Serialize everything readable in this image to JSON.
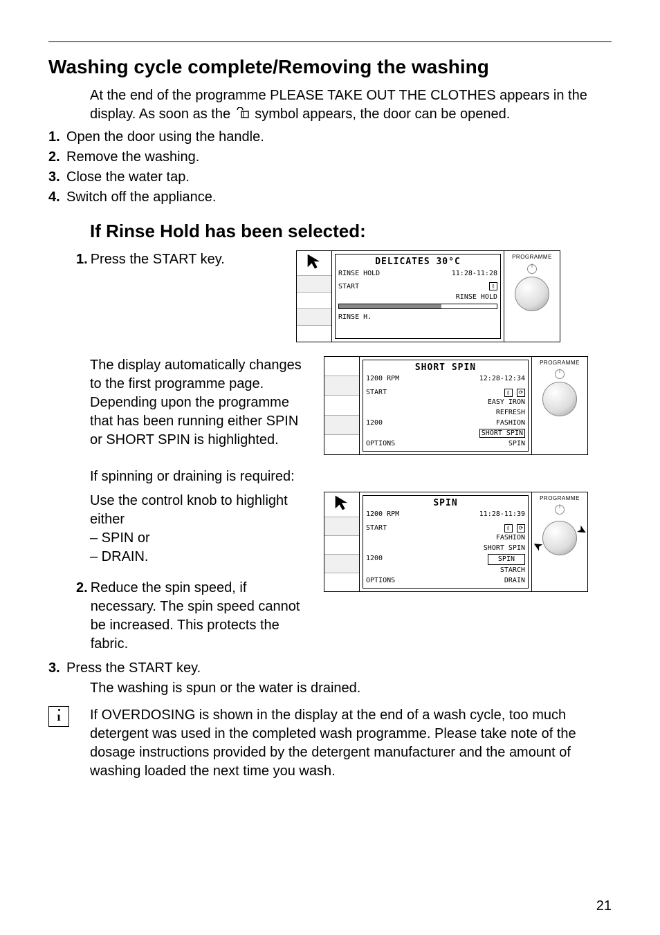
{
  "page_number": "21",
  "h1": "Washing cycle complete/Removing the washing",
  "intro": "At the end of the programme PLEASE TAKE OUT THE CLOTHES appears in the display. As soon as the      symbol appears, the door can be opened.",
  "steps_a": {
    "1": "Open the door using the handle.",
    "2": "Remove the washing.",
    "3": "Close the water tap.",
    "4": "Switch off the appliance."
  },
  "h2": "If Rinse Hold has been selected:",
  "steps_b": {
    "1": "Press the START key.",
    "text_after_fig1": "The display automatically changes to the first programme page. Depending upon the programme that has been running either SPIN or SHORT SPIN is highlighted.",
    "spin_intro": "If spinning or draining is required:",
    "spin_use": "Use the control knob to highlight either",
    "spin_opt1": "– SPIN or",
    "spin_opt2": "– DRAIN.",
    "2": "Reduce the spin speed, if necessary. The spin speed cannot be increased. This protects the fabric.",
    "3": "Press the START key.",
    "3b": "The washing is spun or the water is drained."
  },
  "note": "If OVERDOSING is shown in the display at the end of a wash cycle, too much detergent was used in the completed wash programme. Please take note of the dosage instructions provided by the detergent manufacturer and the amount of washing loaded the next time you wash.",
  "display1": {
    "title": "DELICATES 30°C",
    "top_left": "RINSE HOLD",
    "top_right": "11:28-11:28",
    "row_left": "START",
    "row_right_icon": "door",
    "mid_right": "RINSE HOLD",
    "bottom_left": "RINSE H.",
    "knob_label": "PROGRAMME"
  },
  "display2": {
    "title": "SHORT SPIN",
    "top_left": "1200 RPM",
    "top_right": "12:28-12:34",
    "row_left": "START",
    "menu": [
      "EASY IRON",
      "REFRESH",
      "FASHION",
      "SHORT SPIN",
      "SPIN"
    ],
    "left_mid": "1200",
    "left_bottom": "OPTIONS",
    "knob_label": "PROGRAMME"
  },
  "display3": {
    "title": "SPIN",
    "top_left": "1200 RPM",
    "top_right": "11:28-11:39",
    "row_left": "START",
    "menu": [
      "FASHION",
      "SHORT SPIN",
      "SPIN",
      "STARCH",
      "DRAIN"
    ],
    "left_mid": "1200",
    "left_bottom": "OPTIONS",
    "knob_label": "PROGRAMME"
  }
}
